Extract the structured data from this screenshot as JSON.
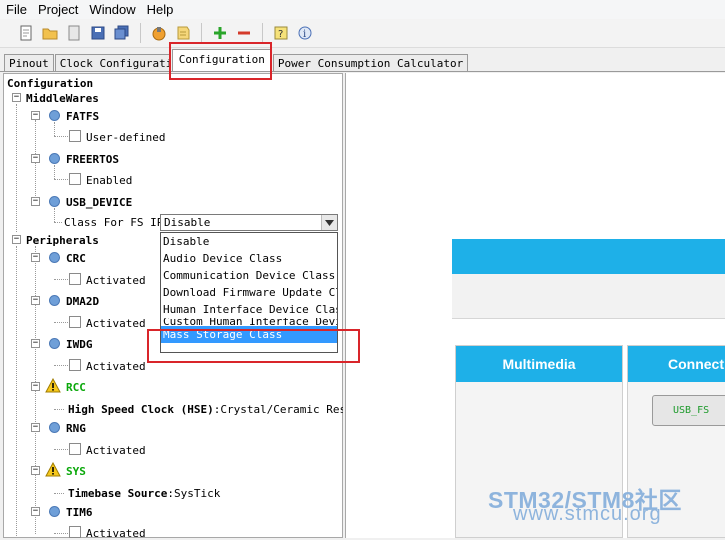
{
  "menu": [
    "File",
    "Project",
    "Window",
    "Help"
  ],
  "tabs": [
    "Pinout",
    "Clock Configuration",
    "Configuration",
    "Power Consumption Calculator"
  ],
  "tree": {
    "root": "Configuration",
    "middlewares": "MiddleWares",
    "fatfs": "FATFS",
    "user_defined": "User-defined",
    "freertos": "FREERTOS",
    "enabled": "Enabled",
    "usb_device": "USB_DEVICE",
    "class_label": "Class For FS IP",
    "peripherals": "Peripherals",
    "crc": "CRC",
    "dma2d": "DMA2D",
    "iwdg": "IWDG",
    "rcc": "RCC",
    "hse_label": "High Speed Clock (HSE)",
    "hse_value": ":Crystal/Ceramic Res",
    "rng": "RNG",
    "sys": "SYS",
    "timebase_label": "Timebase Source",
    "timebase_value": ":SysTick",
    "tim6": "TIM6",
    "activated": "Activated"
  },
  "select": {
    "value": "Disable",
    "options": [
      "Disable",
      "Audio Device Class",
      "Communication Device Class (V",
      "Download Firmware Update Clas",
      "Human Interface Device Class",
      "Custom Human Interface Device",
      "Mass Storage Class"
    ],
    "selected_index": 6
  },
  "right": {
    "multimedia": "Multimedia",
    "connectivity": "Connecti",
    "usb_fs": "USB_FS"
  },
  "watermark": {
    "line1": "STM32/STM8社区",
    "line2": "www.stmcu.org"
  },
  "colors": {
    "accent_blue": "#1eb0e8",
    "highlight": "#3399ff",
    "annotation_red": "#d9252a"
  }
}
